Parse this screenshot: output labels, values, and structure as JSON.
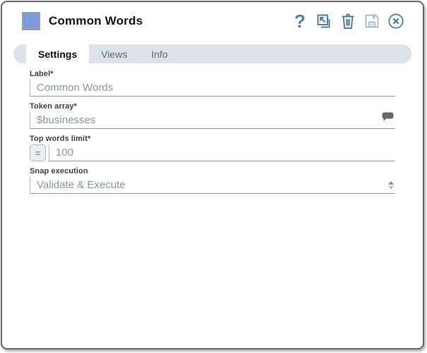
{
  "header": {
    "title": "Common Words",
    "help_glyph": "?"
  },
  "tabs": [
    {
      "label": "Settings",
      "active": true
    },
    {
      "label": "Views",
      "active": false
    },
    {
      "label": "Info",
      "active": false
    }
  ],
  "form": {
    "fields": [
      {
        "label": "Label*",
        "value": "Common Words"
      },
      {
        "label": "Token array*",
        "value": "$businesses",
        "icon": "comment-bubble-icon"
      },
      {
        "label": "Top words limit*",
        "value": "100",
        "expression_toggle": "="
      },
      {
        "label": "Snap execution",
        "value": "Validate & Execute",
        "control": "select"
      }
    ]
  },
  "colors": {
    "snap_icon_blue": "#7d99e0",
    "action_icon_blue": "#53809c",
    "save_icon_disabled": "#a7bfcd",
    "tab_bar_bg": "#dce3e8",
    "input_text": "#8e969c",
    "label_text": "#3a4147"
  }
}
